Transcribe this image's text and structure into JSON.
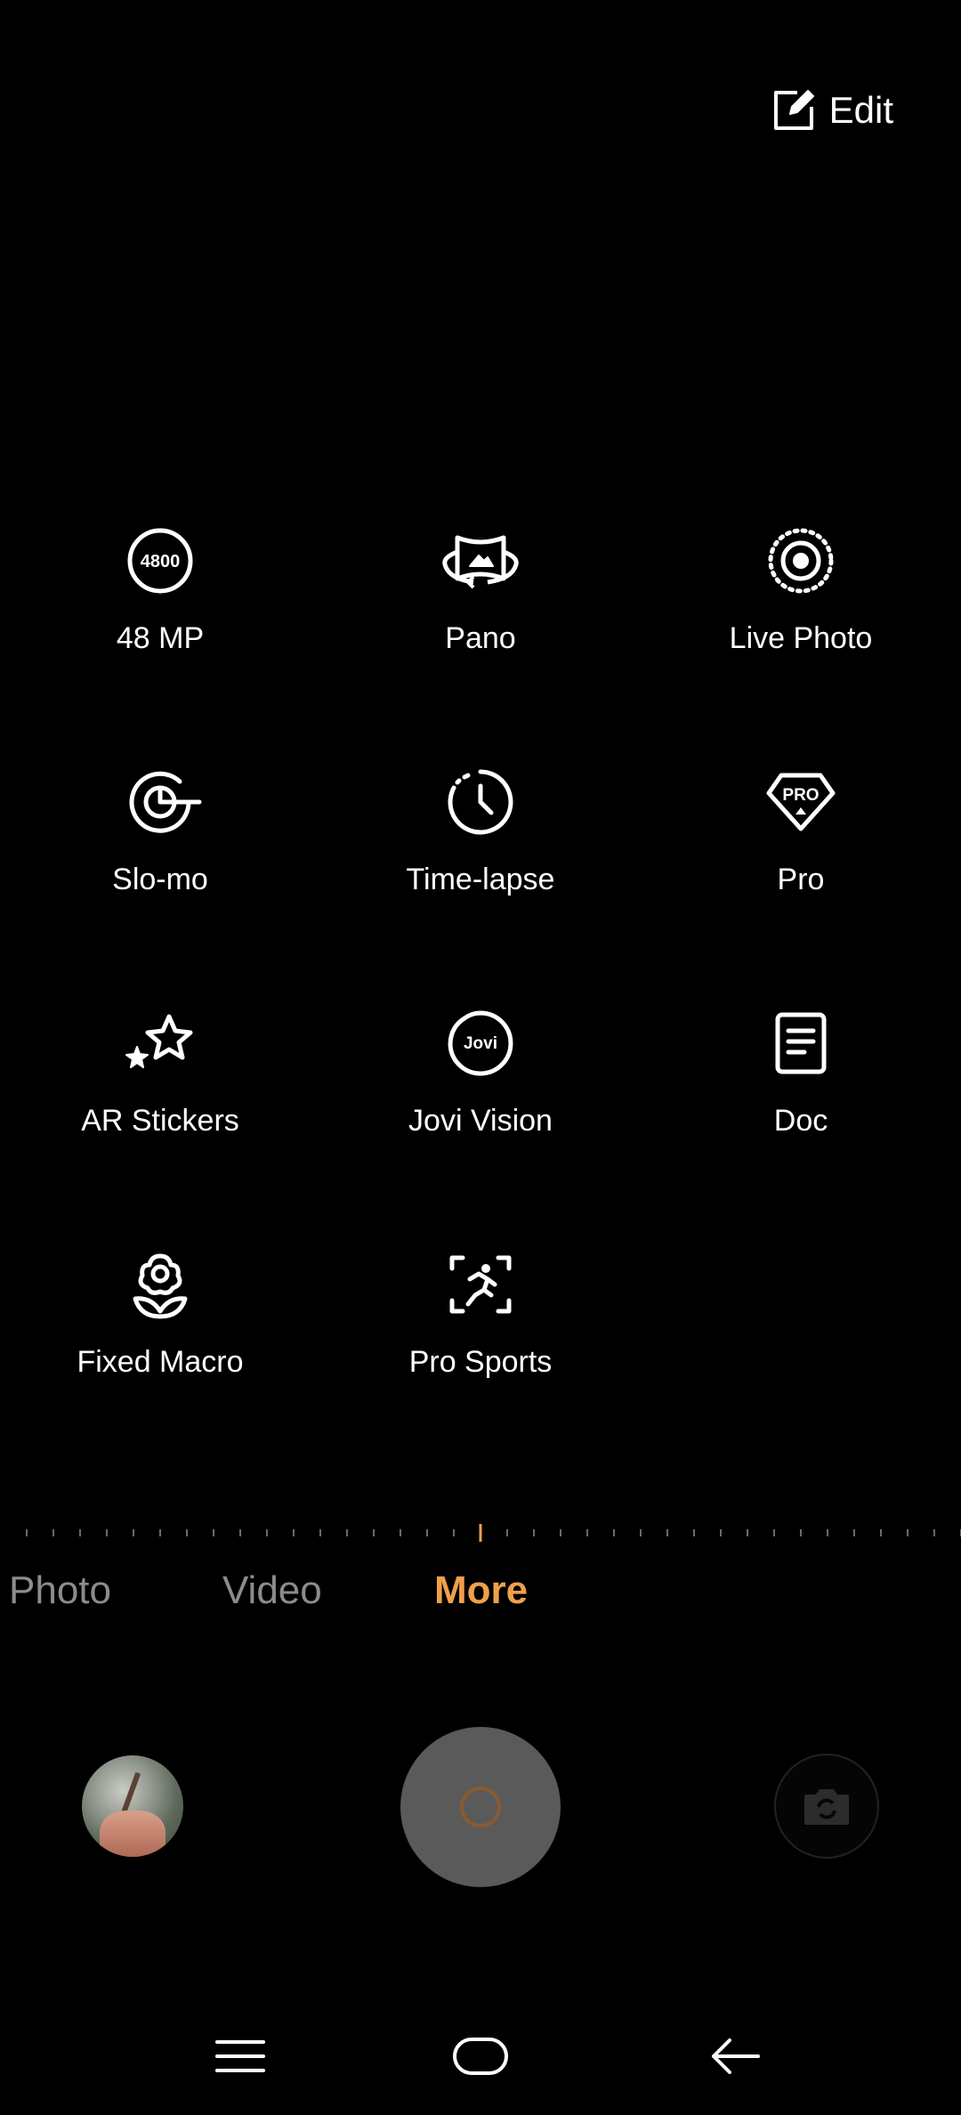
{
  "header": {
    "edit_label": "Edit"
  },
  "modes": [
    {
      "label": "48 MP",
      "icon": "48mp-icon"
    },
    {
      "label": "Pano",
      "icon": "pano-icon"
    },
    {
      "label": "Live Photo",
      "icon": "live-photo-icon"
    },
    {
      "label": "Slo-mo",
      "icon": "slo-mo-icon"
    },
    {
      "label": "Time-lapse",
      "icon": "time-lapse-icon"
    },
    {
      "label": "Pro",
      "icon": "pro-icon"
    },
    {
      "label": "AR Stickers",
      "icon": "ar-stickers-icon"
    },
    {
      "label": "Jovi Vision",
      "icon": "jovi-vision-icon"
    },
    {
      "label": "Doc",
      "icon": "doc-icon"
    },
    {
      "label": "Fixed Macro",
      "icon": "fixed-macro-icon"
    },
    {
      "label": "Pro Sports",
      "icon": "pro-sports-icon"
    }
  ],
  "icon_text": {
    "mp48": "4800",
    "pro": "PRO",
    "jovi": "Jovi"
  },
  "mode_tabs": [
    {
      "label": "Photo",
      "active": false
    },
    {
      "label": "Video",
      "active": false
    },
    {
      "label": "More",
      "active": true
    }
  ],
  "colors": {
    "accent": "#f0a04b",
    "inactive_tab": "#8c8c8c",
    "shutter": "#5a5a5a",
    "background": "#000000"
  },
  "nav": {
    "menu_icon": "menu-icon",
    "home_icon": "home-icon",
    "back_icon": "back-icon"
  }
}
